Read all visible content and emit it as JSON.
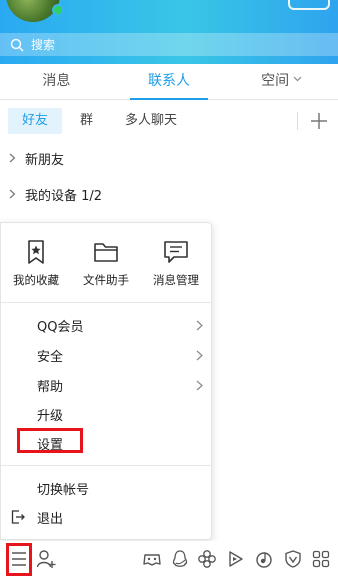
{
  "header": {
    "search_placeholder": "搜索"
  },
  "tabs": [
    {
      "label": "消息"
    },
    {
      "label": "联系人"
    },
    {
      "label": "空间"
    }
  ],
  "subtabs": [
    {
      "label": "好友"
    },
    {
      "label": "群"
    },
    {
      "label": "多人聊天"
    }
  ],
  "groups": [
    {
      "label": "新朋友"
    },
    {
      "label": "我的设备 1/2"
    }
  ],
  "menu": {
    "quick": [
      {
        "label": "我的收藏",
        "icon": "star-bookmark-icon"
      },
      {
        "label": "文件助手",
        "icon": "folder-icon"
      },
      {
        "label": "消息管理",
        "icon": "message-manage-icon"
      }
    ],
    "items": [
      {
        "label": "QQ会员"
      },
      {
        "label": "安全"
      },
      {
        "label": "帮助"
      },
      {
        "label": "升级"
      },
      {
        "label": "设置"
      },
      {
        "label": "切换帐号"
      },
      {
        "label": "退出"
      }
    ]
  },
  "colors": {
    "accent": "#1e9ee8",
    "highlight": "#e8141b"
  }
}
